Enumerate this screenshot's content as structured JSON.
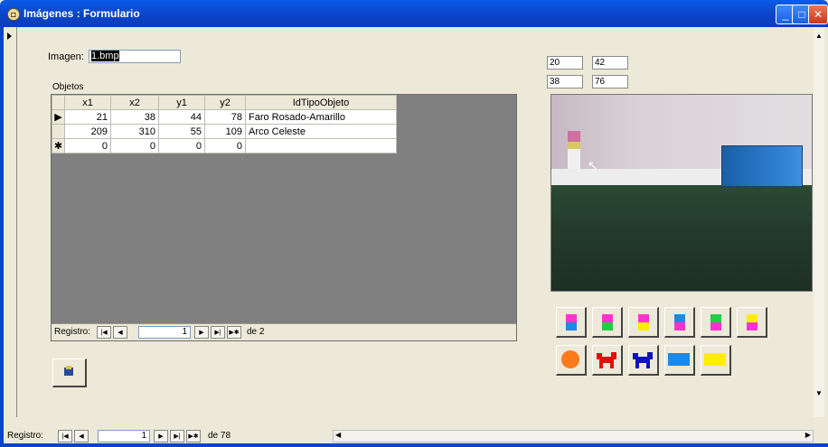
{
  "window": {
    "title": "Imágenes : Formulario",
    "icon": "access-form-icon"
  },
  "main_form": {
    "imagen_label": "Imagen:",
    "imagen_value": "1.bmp"
  },
  "subform": {
    "label": "Objetos",
    "columns": [
      "x1",
      "x2",
      "y1",
      "y2",
      "IdTipoObjeto"
    ],
    "rows": [
      {
        "x1": "21",
        "x2": "38",
        "y1": "44",
        "y2": "78",
        "tipo": "Faro Rosado-Amarillo"
      },
      {
        "x1": "209",
        "x2": "310",
        "y1": "55",
        "y2": "109",
        "tipo": "Arco Celeste"
      },
      {
        "x1": "0",
        "x2": "0",
        "y1": "0",
        "y2": "0",
        "tipo": ""
      }
    ],
    "nav": {
      "label": "Registro:",
      "current": "1",
      "of_text": "de 2"
    }
  },
  "coords": {
    "a": "20",
    "b": "42",
    "c": "38",
    "d": "76"
  },
  "type_buttons": [
    {
      "icon": "faro-pink-blue-icon",
      "top": "#ff33cc",
      "bottom": "#1e88e5"
    },
    {
      "icon": "faro-pink-green-icon",
      "top": "#ff33cc",
      "bottom": "#22cc44"
    },
    {
      "icon": "faro-pink-yellow-icon",
      "top": "#ff33cc",
      "bottom": "#ffee00"
    },
    {
      "icon": "faro-blue-pink-icon",
      "top": "#1e88e5",
      "bottom": "#ff33cc"
    },
    {
      "icon": "faro-green-pink-icon",
      "top": "#22cc44",
      "bottom": "#ff33cc"
    },
    {
      "icon": "faro-yellow-pink-icon",
      "top": "#ffee00",
      "bottom": "#ff33cc"
    }
  ],
  "object_buttons": [
    {
      "icon": "orange-ball-icon",
      "color": "#ff7a1a"
    },
    {
      "icon": "red-dog-robot-icon",
      "color": "#e01010"
    },
    {
      "icon": "blue-dog-robot-icon",
      "color": "#1010c0"
    },
    {
      "icon": "blue-arc-icon",
      "color": "#1e88e5"
    },
    {
      "icon": "yellow-arc-icon",
      "color": "#ffee00"
    }
  ],
  "main_nav": {
    "label": "Registro:",
    "current": "1",
    "of_text": "de 78"
  }
}
